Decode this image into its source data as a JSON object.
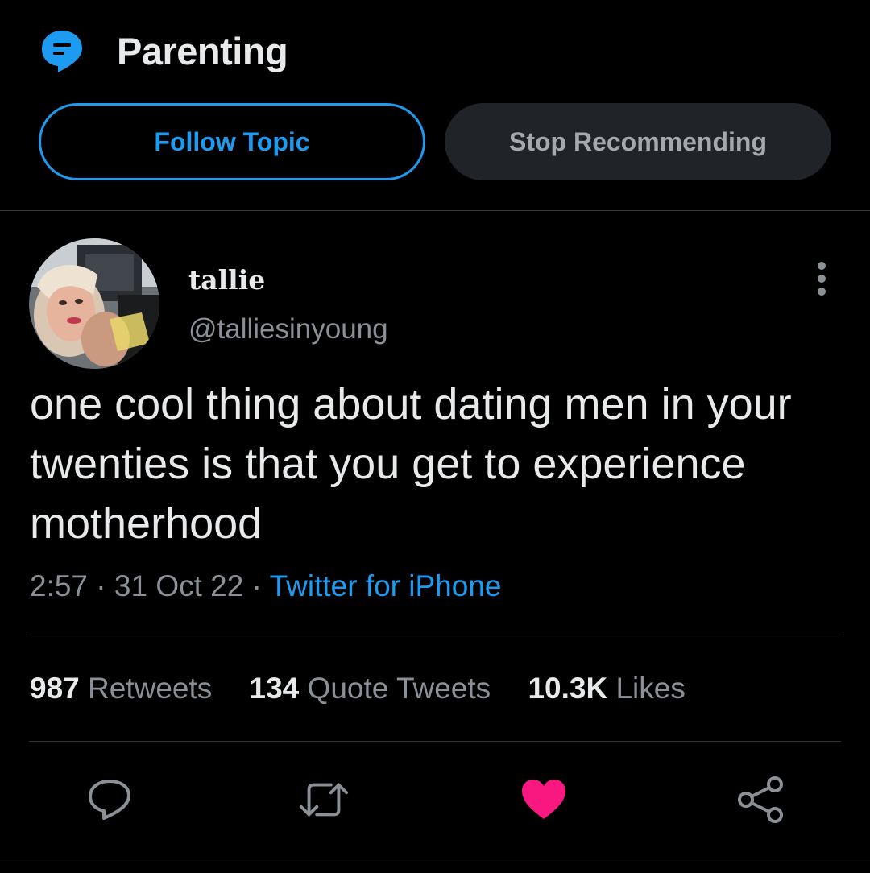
{
  "topic": {
    "title": "Parenting",
    "icon": "topic-speech-bubble-icon",
    "follow_label": "Follow Topic",
    "stop_label": "Stop Recommending"
  },
  "tweet": {
    "display_name": "tallie",
    "handle": "@talliesinyoung",
    "text": "one cool thing about dating men in your twenties is that you get to experience motherhood",
    "time": "2:57",
    "date": "31 Oct 22",
    "separator": "·",
    "source": "Twitter for iPhone"
  },
  "stats": {
    "retweets_count": "987",
    "retweets_label": "Retweets",
    "quotes_count": "134",
    "quotes_label": "Quote Tweets",
    "likes_count": "10.3K",
    "likes_label": "Likes"
  },
  "actions": [
    "reply-icon",
    "retweet-icon",
    "like-heart-icon",
    "share-icon"
  ],
  "colors": {
    "accent": "#1d9bf0",
    "like": "#f91880",
    "muted": "#8b9096",
    "text": "#e7e9ea",
    "background": "#000000"
  }
}
